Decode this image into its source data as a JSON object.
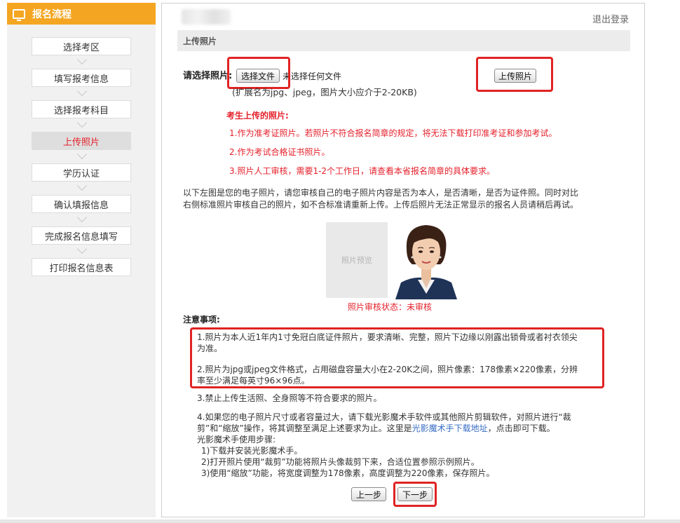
{
  "sidebar": {
    "header": "报名流程",
    "steps": [
      {
        "label": "选择考区"
      },
      {
        "label": "填写报考信息"
      },
      {
        "label": "选择报考科目"
      },
      {
        "label": "上传照片"
      },
      {
        "label": "学历认证"
      },
      {
        "label": "确认填报信息"
      },
      {
        "label": "完成报名信息填写"
      },
      {
        "label": "打印报名信息表"
      }
    ],
    "active_index": 3
  },
  "header": {
    "logout": "退出登录"
  },
  "section_title": "上传照片",
  "upload": {
    "label": "请选择照片:",
    "choose_button": "选择文件",
    "no_file_text": "未选择任何文件",
    "hint": "(扩展名为jpg、jpeg，图片大小应介于2-20KB)",
    "upload_button": "上传照片"
  },
  "notice_red": {
    "title": "考生上传的照片:",
    "items": [
      "1.作为准考证照片。若照片不符合报名简章的规定，将无法下载打印准考证和参加考试。",
      "2.作为考试合格证书照片。",
      "3.照片人工审核，需要1-2个工作日，请查看本省报名简章的具体要求。"
    ]
  },
  "intro": {
    "line1": "以下左图是您的电子照片，请您审核自己的电子照片内容是否为本人，是否清晰，是否为证件照。同时对比",
    "line2": "右侧标准照片审核自己的照片，如不合标准请重新上传。上传后照片无法正常显示的报名人员请稍后再试。"
  },
  "photo": {
    "preview_label": "照片预览",
    "status": "照片审核状态：未审核"
  },
  "notes": {
    "title": "注意事项:",
    "item1_l1": "1.照片为本人近1年内1寸免冠白底证件照片，要求清晰、完整，照片下边缘以刚露出锁骨或者衬衣领尖",
    "item1_l2": "为准。",
    "item2_l1": "2.照片为jpg或jpeg文件格式，占用磁盘容量大小在2-20K之间，照片像素：178像素×220像素，分辨",
    "item2_l2": "率至少满足每英寸96×96点。",
    "item3": "3.禁止上传生活照、全身照等不符合要求的照片。",
    "item4_l1": "4.如果您的电子照片尺寸或者容量过大，请下载光影魔术手软件或其他照片剪辑软件，对照片进行“裁",
    "item4_l2a": "剪”和“缩放”操作，将其调整至满足上述要求为止。这里是",
    "item4_link": "光影魔术手下载地址",
    "item4_l2b": "，点击即可下载。",
    "steps_title": "光影魔术手使用步骤:",
    "step1": "1)下载并安装光影魔术手。",
    "step2": "2)打开照片使用“裁剪”功能将照片头像裁剪下来，合适位置参照示例照片。",
    "step3": "3)使用“缩放”功能，将宽度调整为178像素，高度调整为220像素，保存照片。"
  },
  "nav": {
    "prev": "上一步",
    "next": "下一步"
  },
  "colors": {
    "accent": "#f4a622",
    "alert_red": "#e5202b",
    "highlight_box": "#e02323",
    "link": "#3a6fc4"
  }
}
